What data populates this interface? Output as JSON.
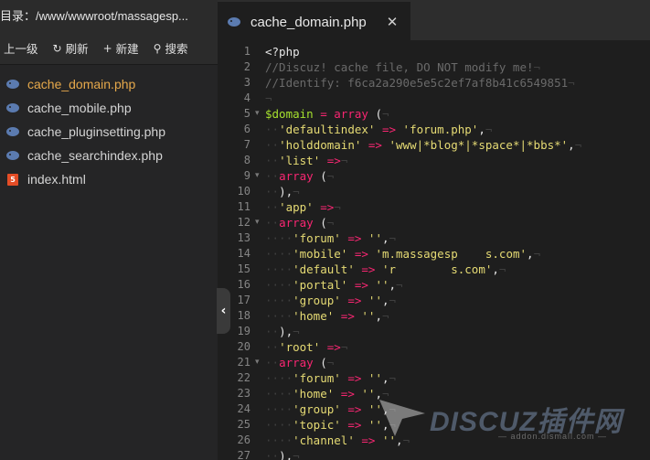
{
  "sidebar": {
    "path": "目录：/www/wwwroot/massagesp...",
    "toolbar": {
      "up_label": "上一级",
      "refresh_label": "刷新",
      "new_label": "新建",
      "search_label": "搜索"
    },
    "files": [
      {
        "name": "cache_domain.php",
        "icon": "php-elephant-icon",
        "active": true
      },
      {
        "name": "cache_mobile.php",
        "icon": "php-elephant-icon"
      },
      {
        "name": "cache_pluginsetting.php",
        "icon": "php-elephant-icon"
      },
      {
        "name": "cache_searchindex.php",
        "icon": "php-elephant-icon"
      },
      {
        "name": "index.html",
        "icon": "html5-icon"
      }
    ]
  },
  "editor": {
    "tab": {
      "title": "cache_domain.php",
      "close": "✕"
    },
    "collapse_glyph": "‹",
    "lines": [
      {
        "n": "1",
        "fold": "",
        "tokens": [
          [
            "p",
            "<?php"
          ]
        ]
      },
      {
        "n": "2",
        "fold": "",
        "tokens": [
          [
            "c",
            "//Discuz! cache file, DO NOT modify me!"
          ],
          [
            "w",
            "¬"
          ]
        ]
      },
      {
        "n": "3",
        "fold": "",
        "tokens": [
          [
            "c",
            "//Identify: f6ca2a290e5e5c2ef7af8b41c6549851"
          ],
          [
            "w",
            "¬"
          ]
        ]
      },
      {
        "n": "4",
        "fold": "",
        "tokens": [
          [
            "w",
            "¬"
          ]
        ]
      },
      {
        "n": "5",
        "fold": "▾",
        "tokens": [
          [
            "v",
            "$domain"
          ],
          [
            "p",
            " "
          ],
          [
            "o",
            "="
          ],
          [
            "p",
            " "
          ],
          [
            "k",
            "array"
          ],
          [
            "p",
            " ("
          ],
          [
            "w",
            "¬"
          ]
        ]
      },
      {
        "n": "6",
        "fold": "",
        "tokens": [
          [
            "w",
            "··"
          ],
          [
            "s",
            "'defaultindex'"
          ],
          [
            "p",
            " "
          ],
          [
            "o",
            "=>"
          ],
          [
            "p",
            " "
          ],
          [
            "s",
            "'forum.php'"
          ],
          [
            "p",
            ","
          ],
          [
            "w",
            "¬"
          ]
        ]
      },
      {
        "n": "7",
        "fold": "",
        "tokens": [
          [
            "w",
            "··"
          ],
          [
            "s",
            "'holddomain'"
          ],
          [
            "p",
            " "
          ],
          [
            "o",
            "=>"
          ],
          [
            "p",
            " "
          ],
          [
            "s",
            "'www|*blog*|*space*|*bbs*'"
          ],
          [
            "p",
            ","
          ],
          [
            "w",
            "¬"
          ]
        ]
      },
      {
        "n": "8",
        "fold": "",
        "tokens": [
          [
            "w",
            "··"
          ],
          [
            "s",
            "'list'"
          ],
          [
            "p",
            " "
          ],
          [
            "o",
            "=>"
          ],
          [
            "w",
            "¬"
          ]
        ]
      },
      {
        "n": "9",
        "fold": "▾",
        "tokens": [
          [
            "w",
            "··"
          ],
          [
            "k",
            "array"
          ],
          [
            "p",
            " ("
          ],
          [
            "w",
            "¬"
          ]
        ]
      },
      {
        "n": "10",
        "fold": "",
        "tokens": [
          [
            "w",
            "··"
          ],
          [
            "p",
            "),"
          ],
          [
            "w",
            "¬"
          ]
        ]
      },
      {
        "n": "11",
        "fold": "",
        "tokens": [
          [
            "w",
            "··"
          ],
          [
            "s",
            "'app'"
          ],
          [
            "p",
            " "
          ],
          [
            "o",
            "=>"
          ],
          [
            "w",
            "¬"
          ]
        ]
      },
      {
        "n": "12",
        "fold": "▾",
        "tokens": [
          [
            "w",
            "··"
          ],
          [
            "k",
            "array"
          ],
          [
            "p",
            " ("
          ],
          [
            "w",
            "¬"
          ]
        ]
      },
      {
        "n": "13",
        "fold": "",
        "tokens": [
          [
            "w",
            "····"
          ],
          [
            "s",
            "'forum'"
          ],
          [
            "p",
            " "
          ],
          [
            "o",
            "=>"
          ],
          [
            "p",
            " "
          ],
          [
            "s",
            "''"
          ],
          [
            "p",
            ","
          ],
          [
            "w",
            "¬"
          ]
        ]
      },
      {
        "n": "14",
        "fold": "",
        "tokens": [
          [
            "w",
            "····"
          ],
          [
            "s",
            "'mobile'"
          ],
          [
            "p",
            " "
          ],
          [
            "o",
            "=>"
          ],
          [
            "p",
            " "
          ],
          [
            "s",
            "'m.massagesp    s.com'"
          ],
          [
            "p",
            ","
          ],
          [
            "w",
            "¬"
          ]
        ]
      },
      {
        "n": "15",
        "fold": "",
        "tokens": [
          [
            "w",
            "····"
          ],
          [
            "s",
            "'default'"
          ],
          [
            "p",
            " "
          ],
          [
            "o",
            "=>"
          ],
          [
            "p",
            " "
          ],
          [
            "s",
            "'r        s.com'"
          ],
          [
            "p",
            ","
          ],
          [
            "w",
            "¬"
          ]
        ]
      },
      {
        "n": "16",
        "fold": "",
        "tokens": [
          [
            "w",
            "····"
          ],
          [
            "s",
            "'portal'"
          ],
          [
            "p",
            " "
          ],
          [
            "o",
            "=>"
          ],
          [
            "p",
            " "
          ],
          [
            "s",
            "''"
          ],
          [
            "p",
            ","
          ],
          [
            "w",
            "¬"
          ]
        ]
      },
      {
        "n": "17",
        "fold": "",
        "tokens": [
          [
            "w",
            "····"
          ],
          [
            "s",
            "'group'"
          ],
          [
            "p",
            " "
          ],
          [
            "o",
            "=>"
          ],
          [
            "p",
            " "
          ],
          [
            "s",
            "''"
          ],
          [
            "p",
            ","
          ],
          [
            "w",
            "¬"
          ]
        ]
      },
      {
        "n": "18",
        "fold": "",
        "tokens": [
          [
            "w",
            "····"
          ],
          [
            "s",
            "'home'"
          ],
          [
            "p",
            " "
          ],
          [
            "o",
            "=>"
          ],
          [
            "p",
            " "
          ],
          [
            "s",
            "''"
          ],
          [
            "p",
            ","
          ],
          [
            "w",
            "¬"
          ]
        ]
      },
      {
        "n": "19",
        "fold": "",
        "tokens": [
          [
            "w",
            "··"
          ],
          [
            "p",
            "),"
          ],
          [
            "w",
            "¬"
          ]
        ]
      },
      {
        "n": "20",
        "fold": "",
        "tokens": [
          [
            "w",
            "··"
          ],
          [
            "s",
            "'root'"
          ],
          [
            "p",
            " "
          ],
          [
            "o",
            "=>"
          ],
          [
            "w",
            "¬"
          ]
        ]
      },
      {
        "n": "21",
        "fold": "▾",
        "tokens": [
          [
            "w",
            "··"
          ],
          [
            "k",
            "array"
          ],
          [
            "p",
            " ("
          ],
          [
            "w",
            "¬"
          ]
        ]
      },
      {
        "n": "22",
        "fold": "",
        "tokens": [
          [
            "w",
            "····"
          ],
          [
            "s",
            "'forum'"
          ],
          [
            "p",
            " "
          ],
          [
            "o",
            "=>"
          ],
          [
            "p",
            " "
          ],
          [
            "s",
            "''"
          ],
          [
            "p",
            ","
          ],
          [
            "w",
            "¬"
          ]
        ]
      },
      {
        "n": "23",
        "fold": "",
        "tokens": [
          [
            "w",
            "····"
          ],
          [
            "s",
            "'home'"
          ],
          [
            "p",
            " "
          ],
          [
            "o",
            "=>"
          ],
          [
            "p",
            " "
          ],
          [
            "s",
            "''"
          ],
          [
            "p",
            ","
          ],
          [
            "w",
            "¬"
          ]
        ]
      },
      {
        "n": "24",
        "fold": "",
        "tokens": [
          [
            "w",
            "····"
          ],
          [
            "s",
            "'group'"
          ],
          [
            "p",
            " "
          ],
          [
            "o",
            "=>"
          ],
          [
            "p",
            " "
          ],
          [
            "s",
            "''"
          ],
          [
            "p",
            ","
          ],
          [
            "w",
            "¬"
          ]
        ]
      },
      {
        "n": "25",
        "fold": "",
        "tokens": [
          [
            "w",
            "····"
          ],
          [
            "s",
            "'topic'"
          ],
          [
            "p",
            " "
          ],
          [
            "o",
            "=>"
          ],
          [
            "p",
            " "
          ],
          [
            "s",
            "''"
          ],
          [
            "p",
            ","
          ],
          [
            "w",
            "¬"
          ]
        ]
      },
      {
        "n": "26",
        "fold": "",
        "tokens": [
          [
            "w",
            "····"
          ],
          [
            "s",
            "'channel'"
          ],
          [
            "p",
            " "
          ],
          [
            "o",
            "=>"
          ],
          [
            "p",
            " "
          ],
          [
            "s",
            "''"
          ],
          [
            "p",
            ","
          ],
          [
            "w",
            "¬"
          ]
        ]
      },
      {
        "n": "27",
        "fold": "",
        "tokens": [
          [
            "w",
            "··"
          ],
          [
            "p",
            "),"
          ],
          [
            "w",
            "¬"
          ]
        ]
      }
    ]
  },
  "watermark": {
    "main": "DISCUZ插件网",
    "sub": "— addon.dismall.com —"
  },
  "colors": {
    "background": "#1e1e1e",
    "sidebar": "#252526",
    "active_file": "#e5a84b",
    "keyword": "#f92672",
    "string": "#e6db74",
    "variable": "#a6e22e",
    "comment": "#6a6a6a"
  }
}
